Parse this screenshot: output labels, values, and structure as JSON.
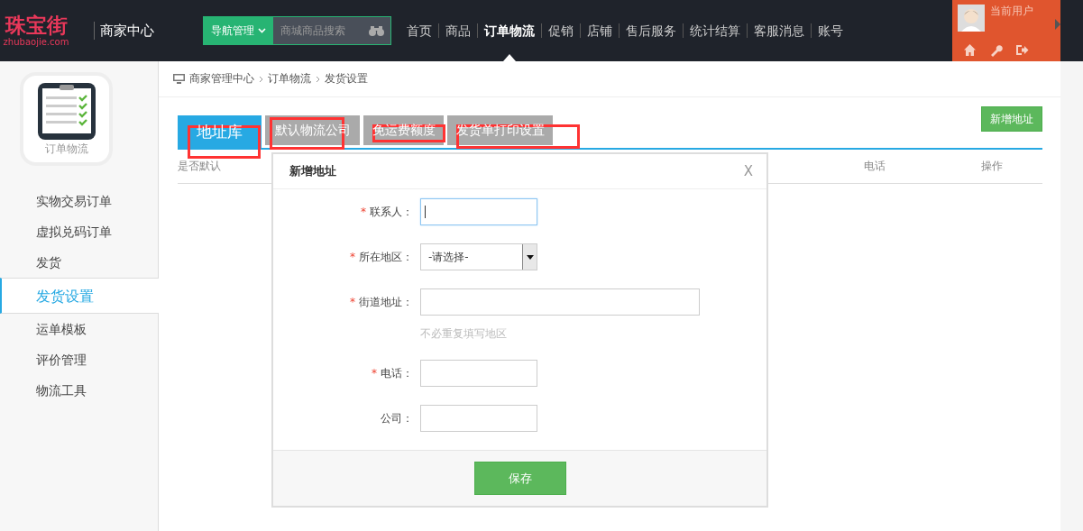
{
  "header": {
    "logo": {
      "name": "珠宝街",
      "domain": "zhubaojie.com"
    },
    "title": "商家中心",
    "nav_dropdown": "导航管理",
    "search": {
      "placeholder": "商城商品搜索"
    },
    "nav": [
      {
        "label": "首页",
        "selected": false
      },
      {
        "label": "商品",
        "selected": false
      },
      {
        "label": "订单物流",
        "selected": true
      },
      {
        "label": "促销",
        "selected": false
      },
      {
        "label": "店铺",
        "selected": false
      },
      {
        "label": "售后服务",
        "selected": false
      },
      {
        "label": "统计结算",
        "selected": false
      },
      {
        "label": "客服消息",
        "selected": false
      },
      {
        "label": "账号",
        "selected": false
      }
    ],
    "user": {
      "label": "当前用户"
    }
  },
  "sidebar": {
    "module": "订单物流",
    "items": [
      {
        "label": "实物交易订单",
        "selected": false
      },
      {
        "label": "虚拟兑码订单",
        "selected": false
      },
      {
        "label": "发货",
        "selected": false
      },
      {
        "label": "发货设置",
        "selected": true
      },
      {
        "label": "运单模板",
        "selected": false
      },
      {
        "label": "评价管理",
        "selected": false
      },
      {
        "label": "物流工具",
        "selected": false
      }
    ]
  },
  "breadcrumb": [
    "商家管理中心",
    "订单物流",
    "发货设置"
  ],
  "tabs": [
    {
      "label": "地址库",
      "selected": true,
      "highlighted": true
    },
    {
      "label": "默认物流公司",
      "selected": false,
      "highlighted": true
    },
    {
      "label": "免运费额度",
      "selected": false,
      "highlighted": true
    },
    {
      "label": "发货单打印设置",
      "selected": false,
      "highlighted": true
    }
  ],
  "add_button": "新增地址",
  "table": {
    "columns": [
      "是否默认",
      "电话",
      "操作"
    ]
  },
  "dialog": {
    "title": "新增地址",
    "close": "X",
    "required_mark": "*",
    "fields": [
      {
        "kind": "text",
        "label": "联系人：",
        "required": true,
        "focused": true
      },
      {
        "kind": "select",
        "label": "所在地区：",
        "required": true,
        "value": "-请选择-"
      },
      {
        "kind": "long_text",
        "label": "街道地址：",
        "required": true,
        "hint": "不必重复填写地区"
      },
      {
        "kind": "text",
        "label": "电话：",
        "required": true
      },
      {
        "kind": "text",
        "label": "公司：",
        "required": false
      }
    ],
    "save": "保存"
  }
}
